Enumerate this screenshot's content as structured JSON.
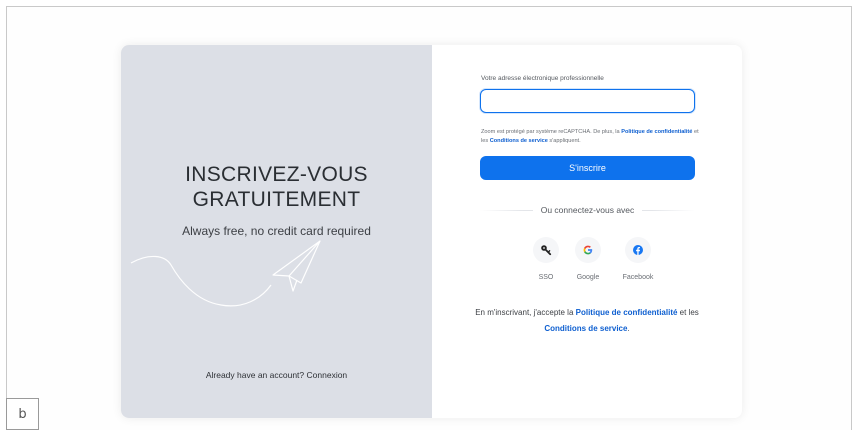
{
  "figure_label": "b",
  "left_panel": {
    "headline_line1": "INSCRIVEZ-VOUS",
    "headline_line2": "GRATUITEMENT",
    "tagline": "Always free, no credit card required",
    "already_text": "Already have an account?",
    "login_link": "Connexion"
  },
  "form": {
    "email_label": "Votre adresse électronique professionnelle",
    "email_value": "",
    "recaptcha_prefix": "Zoom est protégé par système reCAPTCHA. De plus, la",
    "recaptcha_privacy": "Politique de confidentialité",
    "recaptcha_and": "et les",
    "recaptcha_terms": "Conditions de service",
    "recaptcha_suffix": "s'appliquent.",
    "signup_button": "S'inscrire",
    "divider_text": "Ou connectez-vous avec"
  },
  "social": [
    {
      "icon": "key-icon",
      "label": "SSO"
    },
    {
      "icon": "google-icon",
      "label": "Google"
    },
    {
      "icon": "facebook-icon",
      "label": "Facebook"
    }
  ],
  "terms": {
    "prefix": "En m'inscrivant, j'accepte la",
    "privacy": "Politique de confidentialité",
    "and": "et les",
    "conditions": "Conditions de service",
    "suffix": "."
  },
  "colors": {
    "accent": "#0e72ed",
    "left_panel_bg": "#dcdfe6",
    "link": "#0e5fd0",
    "google_blue": "#4285f4",
    "facebook_blue": "#1877f2"
  }
}
